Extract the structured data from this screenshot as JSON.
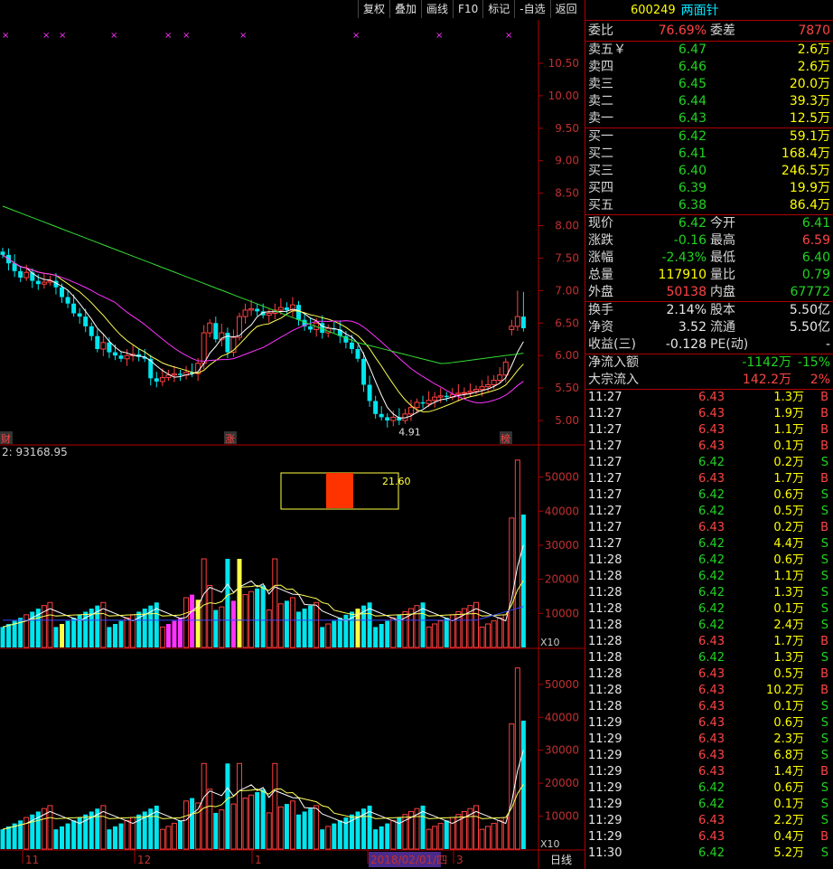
{
  "toolbar": {
    "buttons": [
      "复权",
      "叠加",
      "画线",
      "F10",
      "标记",
      "-自选",
      "返回"
    ]
  },
  "stock": {
    "code": "600249",
    "name": "两面针"
  },
  "weibi": {
    "label": "委比",
    "value": "76.69%",
    "label2": "委差",
    "value2": "7870"
  },
  "asks": [
    {
      "label": "卖五￥",
      "price": "6.47",
      "vol": "2.6万"
    },
    {
      "label": "卖四",
      "price": "6.46",
      "vol": "2.6万"
    },
    {
      "label": "卖三",
      "price": "6.45",
      "vol": "20.0万"
    },
    {
      "label": "卖二",
      "price": "6.44",
      "vol": "39.3万"
    },
    {
      "label": "卖一",
      "price": "6.43",
      "vol": "12.5万"
    }
  ],
  "bids": [
    {
      "label": "买一",
      "price": "6.42",
      "vol": "59.1万"
    },
    {
      "label": "买二",
      "price": "6.41",
      "vol": "168.4万"
    },
    {
      "label": "买三",
      "price": "6.40",
      "vol": "246.5万"
    },
    {
      "label": "买四",
      "price": "6.39",
      "vol": "19.9万"
    },
    {
      "label": "买五",
      "price": "6.38",
      "vol": "86.4万"
    }
  ],
  "quote": [
    {
      "l1": "现价",
      "v1": "6.42",
      "l2": "今开",
      "v2": "6.41"
    },
    {
      "l1": "涨跌",
      "v1": "-0.16",
      "l2": "最高",
      "v2": "6.59"
    },
    {
      "l1": "涨幅",
      "v1": "-2.43%",
      "l2": "最低",
      "v2": "6.40"
    },
    {
      "l1": "总量",
      "v1": "117910",
      "l2": "量比",
      "v2": "0.79"
    },
    {
      "l1": "外盘",
      "v1": "50138",
      "l2": "内盘",
      "v2": "67772"
    }
  ],
  "fund": [
    {
      "l1": "换手",
      "v1": "2.14%",
      "l2": "股本",
      "v2": "5.50亿"
    },
    {
      "l1": "净资",
      "v1": "3.52",
      "l2": "流通",
      "v2": "5.50亿"
    },
    {
      "l1": "收益(三)",
      "v1": "-0.128",
      "l2": "PE(动)",
      "v2": "-"
    }
  ],
  "flow": [
    {
      "label": "净流入额",
      "v1": "-1142万",
      "v2": "-15%"
    },
    {
      "label": "大宗流入",
      "v1": "142.2万",
      "v2": "2%"
    }
  ],
  "ticks": [
    {
      "time": "11:27",
      "price": "6.43",
      "vol": "1.3万",
      "side": "B"
    },
    {
      "time": "11:27",
      "price": "6.43",
      "vol": "1.9万",
      "side": "B"
    },
    {
      "time": "11:27",
      "price": "6.43",
      "vol": "1.1万",
      "side": "B"
    },
    {
      "time": "11:27",
      "price": "6.43",
      "vol": "0.1万",
      "side": "B"
    },
    {
      "time": "11:27",
      "price": "6.42",
      "vol": "0.2万",
      "side": "S"
    },
    {
      "time": "11:27",
      "price": "6.43",
      "vol": "1.7万",
      "side": "B"
    },
    {
      "time": "11:27",
      "price": "6.42",
      "vol": "0.6万",
      "side": "S"
    },
    {
      "time": "11:27",
      "price": "6.42",
      "vol": "0.5万",
      "side": "S"
    },
    {
      "time": "11:27",
      "price": "6.43",
      "vol": "0.2万",
      "side": "B"
    },
    {
      "time": "11:27",
      "price": "6.42",
      "vol": "4.4万",
      "side": "S"
    },
    {
      "time": "11:28",
      "price": "6.42",
      "vol": "0.6万",
      "side": "S"
    },
    {
      "time": "11:28",
      "price": "6.42",
      "vol": "1.1万",
      "side": "S"
    },
    {
      "time": "11:28",
      "price": "6.42",
      "vol": "1.3万",
      "side": "S"
    },
    {
      "time": "11:28",
      "price": "6.42",
      "vol": "0.1万",
      "side": "S"
    },
    {
      "time": "11:28",
      "price": "6.42",
      "vol": "2.4万",
      "side": "S"
    },
    {
      "time": "11:28",
      "price": "6.43",
      "vol": "1.7万",
      "side": "B"
    },
    {
      "time": "11:28",
      "price": "6.42",
      "vol": "1.3万",
      "side": "S"
    },
    {
      "time": "11:28",
      "price": "6.43",
      "vol": "0.5万",
      "side": "B"
    },
    {
      "time": "11:28",
      "price": "6.43",
      "vol": "10.2万",
      "side": "B"
    },
    {
      "time": "11:28",
      "price": "6.43",
      "vol": "0.1万",
      "side": "S"
    },
    {
      "time": "11:29",
      "price": "6.43",
      "vol": "0.6万",
      "side": "S"
    },
    {
      "time": "11:29",
      "price": "6.43",
      "vol": "2.3万",
      "side": "S"
    },
    {
      "time": "11:29",
      "price": "6.43",
      "vol": "6.8万",
      "side": "S"
    },
    {
      "time": "11:29",
      "price": "6.43",
      "vol": "1.4万",
      "side": "B"
    },
    {
      "time": "11:29",
      "price": "6.42",
      "vol": "0.6万",
      "side": "S"
    },
    {
      "time": "11:29",
      "price": "6.42",
      "vol": "0.1万",
      "side": "S"
    },
    {
      "time": "11:29",
      "price": "6.43",
      "vol": "2.2万",
      "side": "S"
    },
    {
      "time": "11:29",
      "price": "6.43",
      "vol": "0.4万",
      "side": "B"
    },
    {
      "time": "11:30",
      "price": "6.42",
      "vol": "5.2万",
      "side": "S"
    }
  ],
  "colors": {
    "up": "#ff4040",
    "down": "#00e5ee",
    "ma5": "#ffffff",
    "ma10": "#ffff55",
    "ma20": "#ff33ff",
    "ma60": "#33dd33",
    "axis": "#b00000"
  },
  "chart_data": [
    {
      "type": "candlestick",
      "y_ticks": [
        "10.50",
        "10.00",
        "9.50",
        "9.00",
        "8.50",
        "8.00",
        "7.50",
        "7.00",
        "6.50",
        "6.00",
        "5.50",
        "5.00"
      ],
      "ylim": [
        4.8,
        10.7
      ],
      "annotations": [
        "4.91",
        "财",
        "涨",
        "榜"
      ],
      "series": [
        {
          "name": "close",
          "values": [
            7.55,
            7.42,
            7.3,
            7.2,
            7.28,
            7.15,
            7.1,
            7.13,
            7.15,
            7.05,
            6.9,
            6.8,
            6.65,
            6.6,
            6.45,
            6.3,
            6.1,
            6.2,
            6.05,
            6.0,
            5.95,
            6.0,
            6.02,
            5.98,
            5.95,
            5.65,
            5.6,
            5.66,
            5.7,
            5.72,
            5.7,
            5.74,
            5.72,
            5.88,
            6.35,
            6.5,
            6.25,
            6.35,
            6.05,
            6.28,
            6.6,
            6.7,
            6.72,
            6.68,
            6.62,
            6.65,
            6.7,
            6.74,
            6.7,
            6.78,
            6.55,
            6.45,
            6.4,
            6.5,
            6.35,
            6.42,
            6.4,
            6.3,
            6.2,
            6.1,
            5.95,
            5.55,
            5.3,
            5.1,
            5.05,
            5.0,
            5.05,
            5.0,
            5.1,
            5.2,
            5.28,
            5.26,
            5.31,
            5.36,
            5.38,
            5.36,
            5.4,
            5.42,
            5.43,
            5.45,
            5.48,
            5.52,
            5.55,
            5.62,
            5.7,
            5.9,
            6.45,
            6.6,
            6.42
          ]
        }
      ]
    },
    {
      "type": "bar",
      "label": "2: 93168.95",
      "y_ticks": [
        "50000",
        "40000",
        "30000",
        "20000",
        "10000"
      ],
      "ylim": [
        0,
        56000
      ],
      "box_value": "21.60",
      "unit": "X10"
    },
    {
      "type": "bar",
      "y_ticks": [
        "50000",
        "40000",
        "30000",
        "20000",
        "10000"
      ],
      "ylim": [
        0,
        56000
      ],
      "unit": "X10",
      "x_labels": [
        "11",
        "12",
        "1",
        "2018/02/01/四",
        "3",
        "日线"
      ]
    }
  ]
}
